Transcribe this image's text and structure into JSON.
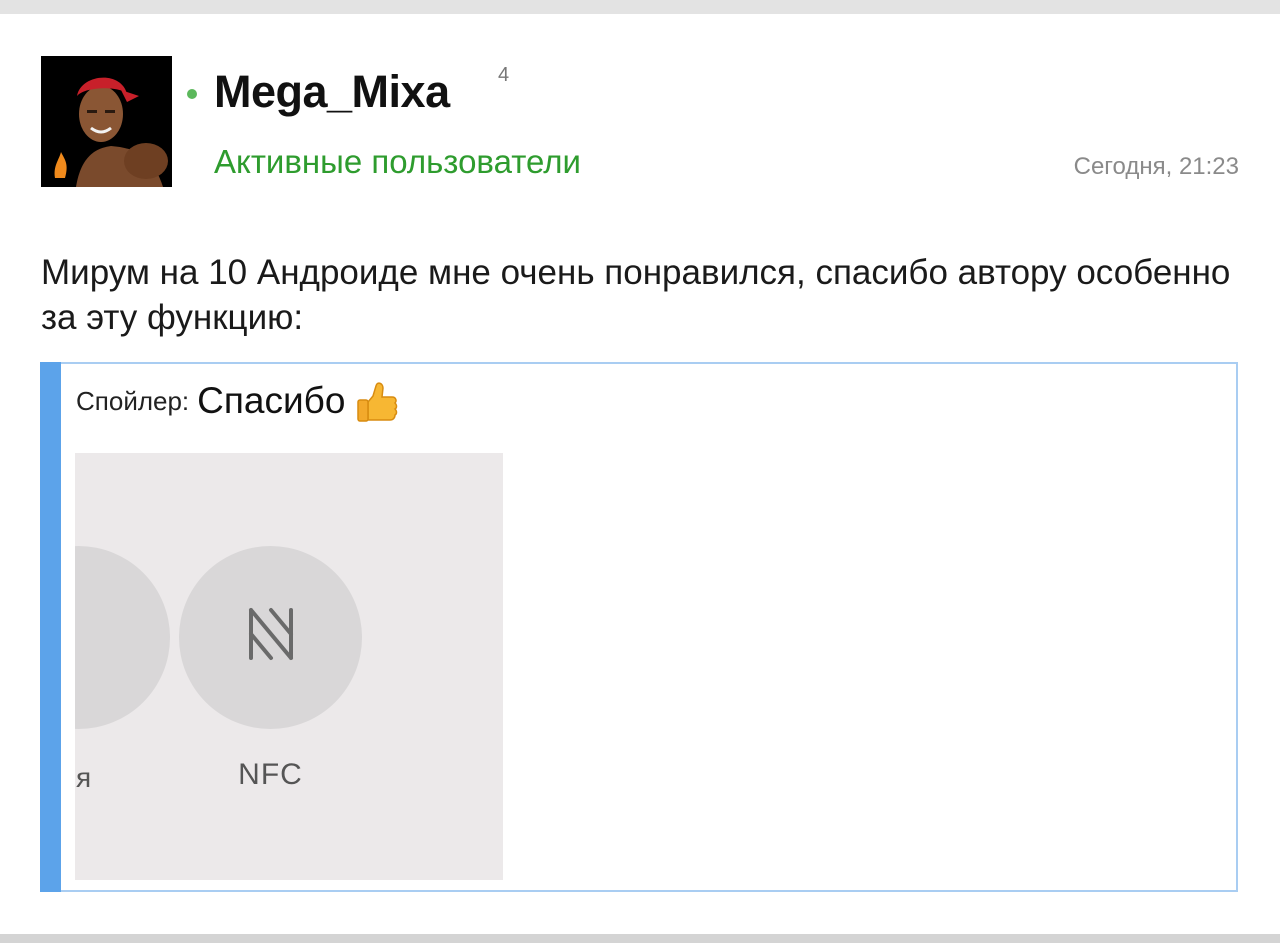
{
  "post": {
    "author": {
      "username": "Mega_Mixa",
      "rank_number": "4",
      "group": "Активные пользователи",
      "online_color": "#5cb85c",
      "group_color": "#2e9c2e"
    },
    "timestamp": "Сегодня, 21:23",
    "text": "Мирум на 10 Андроиде мне очень понравился, спасибо автору особенно за эту функцию:"
  },
  "spoiler": {
    "label": "Спойлер:",
    "title": "Спасибо",
    "emoji_icon": "thumbs-up-icon",
    "accent_color": "#5ca3ea",
    "image": {
      "tiles": [
        {
          "label": "я"
        },
        {
          "label": "NFC",
          "icon": "nfc-icon"
        }
      ]
    }
  }
}
